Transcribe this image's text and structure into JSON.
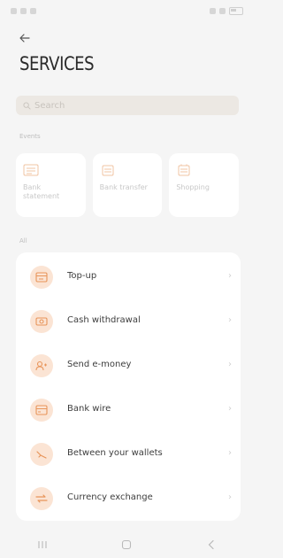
{
  "header": {
    "title": "SERVICES"
  },
  "search": {
    "placeholder": "Search"
  },
  "sections": {
    "quick_label": "Events",
    "all_label": "All"
  },
  "quick_actions": [
    {
      "label": "Bank statement",
      "icon": "bank-statement-icon"
    },
    {
      "label": "Bank transfer",
      "icon": "bank-transfer-icon"
    },
    {
      "label": "Shopping",
      "icon": "shopping-icon"
    }
  ],
  "services": [
    {
      "label": "Top-up",
      "icon": "top-up-icon"
    },
    {
      "label": "Cash withdrawal",
      "icon": "cash-withdrawal-icon"
    },
    {
      "label": "Send e-money",
      "icon": "send-money-icon"
    },
    {
      "label": "Bank wire",
      "icon": "bank-wire-icon"
    },
    {
      "label": "Between your wallets",
      "icon": "wallet-transfer-icon"
    },
    {
      "label": "Currency exchange",
      "icon": "currency-exchange-icon"
    }
  ],
  "colors": {
    "accent": "#e8955a",
    "icon_bg": "#fbe4d4",
    "background": "#f5f5f5"
  }
}
